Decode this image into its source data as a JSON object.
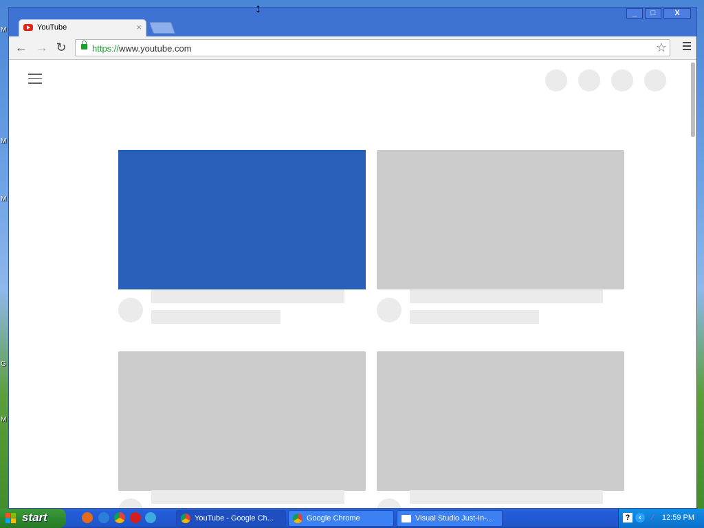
{
  "browser": {
    "tab": {
      "title": "YouTube",
      "close": "×"
    },
    "window_buttons": [
      "_",
      "□",
      "X"
    ],
    "omnibox": {
      "scheme": "https://",
      "host": "www.youtube.com"
    }
  },
  "taskbar": {
    "start_label": "start",
    "tasks": [
      {
        "label": "YouTube - Google Ch..."
      },
      {
        "label": "Google Chrome"
      },
      {
        "label": "Visual Studio Just-In-..."
      }
    ],
    "clock": "12:59 PM",
    "tray_help": "?"
  },
  "colors": {
    "loaded_thumbnail": "#285fb9",
    "placeholder": "#cccccc"
  }
}
